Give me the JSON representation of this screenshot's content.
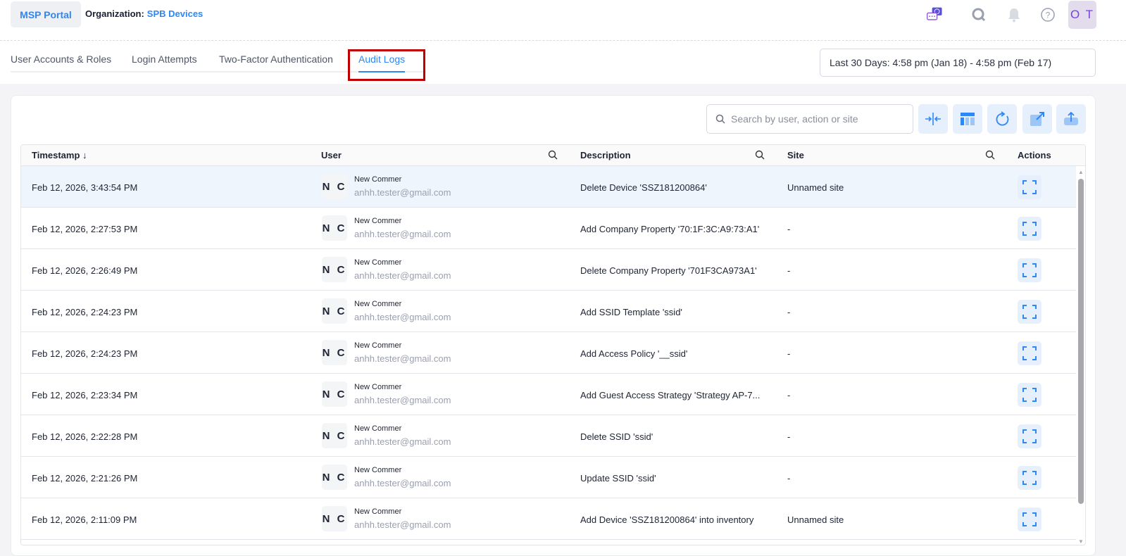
{
  "header": {
    "portal_label": "MSP Portal",
    "org_label": "Organization:",
    "org_value": "SPB Devices",
    "avatar": "O T",
    "icons": [
      "chat-ai-icon",
      "search-icon",
      "bell-icon",
      "help-icon"
    ]
  },
  "tabs": [
    {
      "label": "User Accounts & Roles"
    },
    {
      "label": "Login Attempts"
    },
    {
      "label": "Two-Factor Authentication"
    },
    {
      "label": "Audit Logs",
      "active": true
    }
  ],
  "date_range": "Last 30 Days: 4:58 pm (Jan 18) - 4:58 pm (Feb 17)",
  "toolbar": {
    "search_placeholder": "Search by user, action or site",
    "buttons": [
      "collapse-icon",
      "columns-icon",
      "refresh-icon",
      "open-external-icon",
      "export-icon"
    ]
  },
  "table": {
    "columns": {
      "timestamp": "Timestamp",
      "user": "User",
      "description": "Description",
      "site": "Site",
      "actions": "Actions"
    },
    "rows": [
      {
        "timestamp": "Feb 12, 2026, 3:43:54 PM",
        "initials": "N C",
        "name": "New Commer",
        "email": "anhh.tester@gmail.com",
        "description": "Delete Device 'SSZ181200864'",
        "site": "Unnamed site"
      },
      {
        "timestamp": "Feb 12, 2026, 2:27:53 PM",
        "initials": "N C",
        "name": "New Commer",
        "email": "anhh.tester@gmail.com",
        "description": "Add Company Property '70:1F:3C:A9:73:A1'",
        "site": "-"
      },
      {
        "timestamp": "Feb 12, 2026, 2:26:49 PM",
        "initials": "N C",
        "name": "New Commer",
        "email": "anhh.tester@gmail.com",
        "description": "Delete Company Property '701F3CA973A1'",
        "site": "-"
      },
      {
        "timestamp": "Feb 12, 2026, 2:24:23 PM",
        "initials": "N C",
        "name": "New Commer",
        "email": "anhh.tester@gmail.com",
        "description": "Add SSID Template 'ssid'",
        "site": "-"
      },
      {
        "timestamp": "Feb 12, 2026, 2:24:23 PM",
        "initials": "N C",
        "name": "New Commer",
        "email": "anhh.tester@gmail.com",
        "description": "Add Access Policy '__ssid'",
        "site": "-"
      },
      {
        "timestamp": "Feb 12, 2026, 2:23:34 PM",
        "initials": "N C",
        "name": "New Commer",
        "email": "anhh.tester@gmail.com",
        "description": "Add Guest Access Strategy 'Strategy AP-7...",
        "site": "-"
      },
      {
        "timestamp": "Feb 12, 2026, 2:22:28 PM",
        "initials": "N C",
        "name": "New Commer",
        "email": "anhh.tester@gmail.com",
        "description": "Delete SSID 'ssid'",
        "site": "-"
      },
      {
        "timestamp": "Feb 12, 2026, 2:21:26 PM",
        "initials": "N C",
        "name": "New Commer",
        "email": "anhh.tester@gmail.com",
        "description": "Update SSID 'ssid'",
        "site": "-"
      },
      {
        "timestamp": "Feb 12, 2026, 2:11:09 PM",
        "initials": "N C",
        "name": "New Commer",
        "email": "anhh.tester@gmail.com",
        "description": "Add Device 'SSZ181200864' into inventory",
        "site": "Unnamed site"
      }
    ]
  },
  "colors": {
    "accent": "#2f86f5",
    "highlight_box": "#c00000",
    "selected_row": "#eef5fd"
  }
}
